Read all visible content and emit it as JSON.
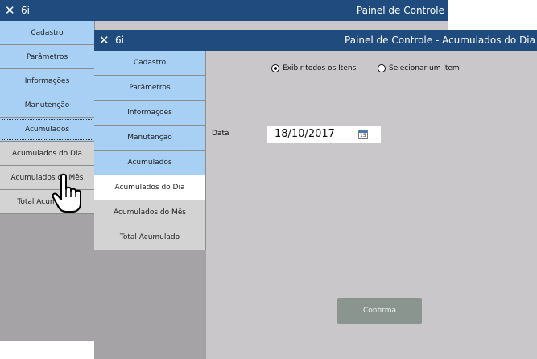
{
  "back_window": {
    "close_glyph": "✕",
    "app_name": "6i",
    "title": "Painel de Controle",
    "nav": [
      "Cadastro",
      "Parâmetros",
      "Informações",
      "Manutenção",
      "Acumulados",
      "Acumulados do Dia",
      "Acumulados do Mês",
      "Total Acumulado"
    ]
  },
  "front_window": {
    "close_glyph": "✕",
    "app_name": "6i",
    "title": "Painel de Controle - Acumulados do Dia",
    "nav": [
      "Cadastro",
      "Parâmetros",
      "Informações",
      "Manutenção",
      "Acumulados",
      "Acumulados do Dia",
      "Acumulados do Mês",
      "Total Acumulado"
    ],
    "radio_all": "Exibir todos os Itens",
    "radio_one": "Selecionar um item",
    "date_label": "Data",
    "date_value": "18/10/2017",
    "calendar_icon_text": "15",
    "confirm_label": "Confirma"
  },
  "colors": {
    "titlebar": "#1f4b7e",
    "nav_blue": "#a8d0f5",
    "panel_bg": "#c9c7c9",
    "confirm_bg": "#8a9590"
  }
}
